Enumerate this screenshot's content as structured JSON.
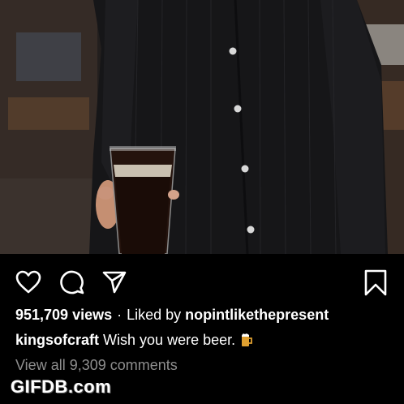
{
  "post": {
    "views": "951,709 views",
    "separator": "·",
    "liked_prefix": "Liked by",
    "liked_user": "nopintlikethepresent",
    "username": "kingsofcraft",
    "caption": "Wish you were beer.",
    "caption_emoji": "beer-mug-icon",
    "comments_link": "View all 9,309 comments"
  },
  "actions": {
    "like_icon": "heart-icon",
    "comment_icon": "comment-icon",
    "share_icon": "paper-plane-icon",
    "save_icon": "bookmark-icon"
  },
  "watermark": "GIFDB.com",
  "colors": {
    "background": "#000000",
    "text": "#ffffff",
    "muted_text": "#8e8e8e"
  }
}
